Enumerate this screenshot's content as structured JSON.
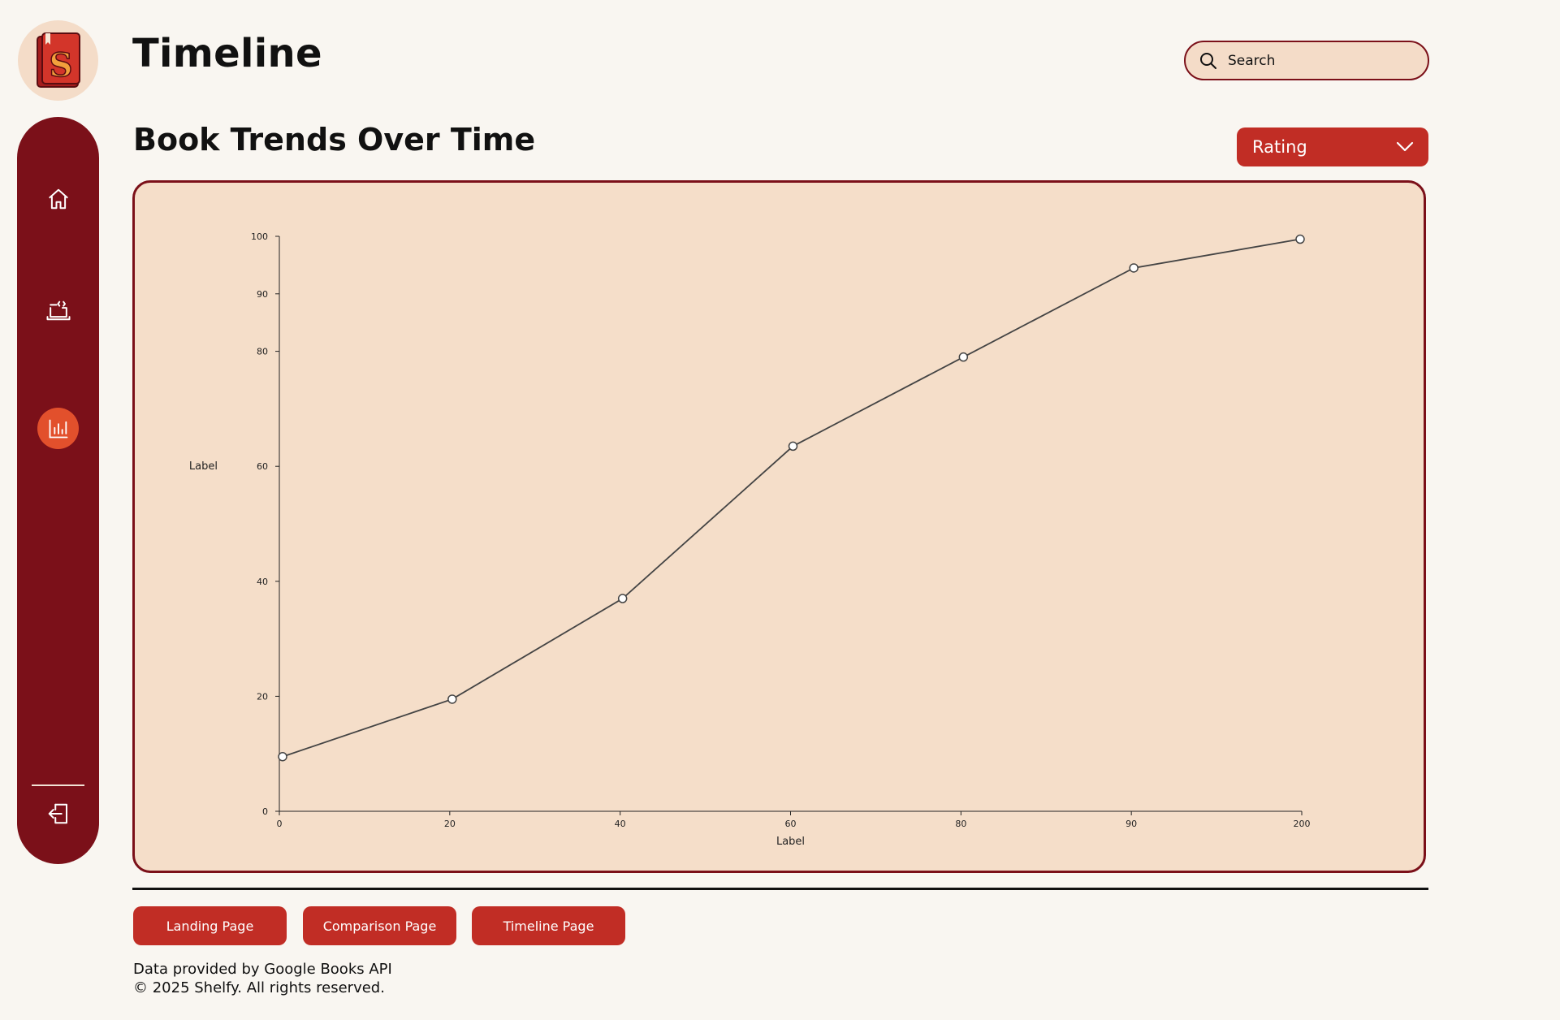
{
  "header": {
    "title": "Timeline",
    "search_placeholder": "Search"
  },
  "sidebar": {
    "items": [
      {
        "name": "home",
        "icon": "home-icon",
        "active": false
      },
      {
        "name": "comparison",
        "icon": "laptop-code-icon",
        "active": false
      },
      {
        "name": "timeline",
        "icon": "bar-chart-icon",
        "active": true
      }
    ],
    "logout_icon": "logout-icon"
  },
  "main": {
    "section_title": "Book Trends Over Time",
    "dropdown_selected": "Rating"
  },
  "chart_data": {
    "type": "line",
    "categories": [
      "0",
      "20",
      "40",
      "60",
      "80",
      "90",
      "200"
    ],
    "values": [
      9.5,
      19.5,
      37,
      63.5,
      79,
      94.5,
      99.5
    ],
    "y_ticks": [
      0,
      20,
      40,
      60,
      80,
      90,
      100
    ],
    "xlabel": "Label",
    "ylabel": "Label",
    "ylim": [
      0,
      100
    ],
    "grid": false,
    "line_color": "#444444",
    "marker_fill": "#ffffff"
  },
  "footer": {
    "buttons": [
      "Landing Page",
      "Comparison Page",
      "Timeline Page"
    ],
    "credit": "Data provided by Google Books API",
    "copyright": "© 2025 Shelfy. All rights reserved."
  },
  "colors": {
    "sidebar": "#7b1019",
    "accent": "#c12d25",
    "active": "#e2502c",
    "panel": "#f5dec9",
    "background": "#f9f6f1"
  }
}
